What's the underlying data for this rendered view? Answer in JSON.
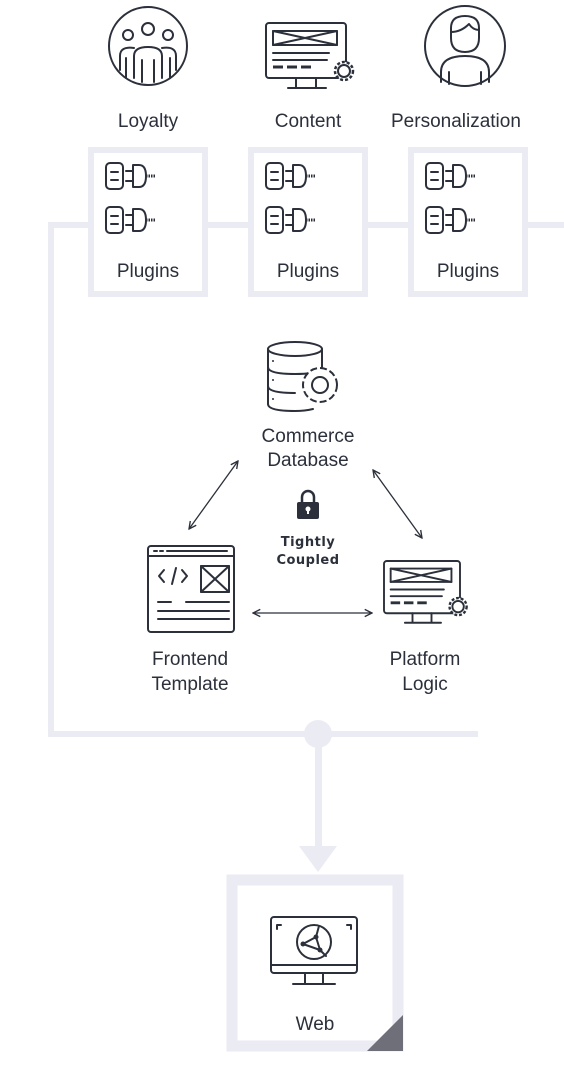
{
  "colors": {
    "connector": "#ebebf3",
    "ink": "#2b303b",
    "corner": "#6f6f7a"
  },
  "services": [
    {
      "label": "Loyalty",
      "icon": "group-of-people-icon"
    },
    {
      "label": "Content",
      "icon": "monitor-gear-icon"
    },
    {
      "label": "Personalization",
      "icon": "person-icon"
    }
  ],
  "plugins": [
    {
      "label": "Plugins",
      "icon": "plug-icon"
    },
    {
      "label": "Plugins",
      "icon": "plug-icon"
    },
    {
      "label": "Plugins",
      "icon": "plug-icon"
    }
  ],
  "core": {
    "database": {
      "line1": "Commerce",
      "line2": "Database",
      "icon": "database-gear-icon"
    },
    "frontend": {
      "line1": "Frontend",
      "line2": "Template",
      "icon": "code-template-icon"
    },
    "platform": {
      "line1": "Platform",
      "line2": "Logic",
      "icon": "monitor-gear-icon"
    },
    "coupling": {
      "line1": "Tightly",
      "line2": "Coupled",
      "icon": "lock-icon"
    }
  },
  "output": {
    "label": "Web",
    "icon": "monitor-globe-icon"
  }
}
